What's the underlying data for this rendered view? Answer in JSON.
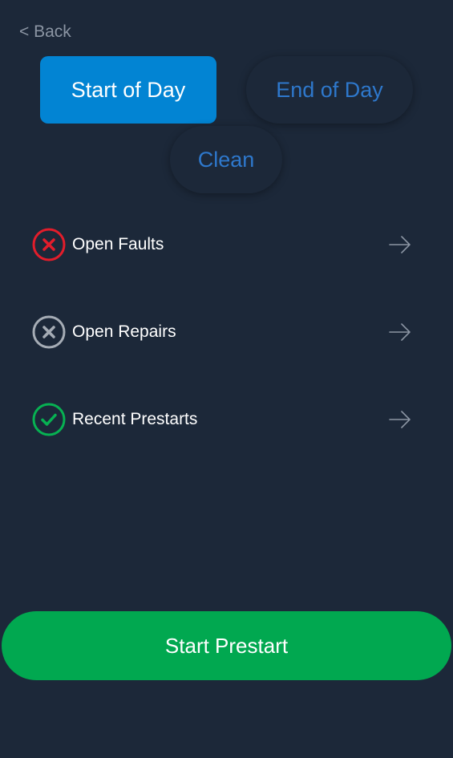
{
  "nav": {
    "back_label": "< Back"
  },
  "tabs": [
    {
      "label": "Start of Day",
      "active": true
    },
    {
      "label": "End of Day",
      "active": false
    },
    {
      "label": "Clean",
      "active": false
    }
  ],
  "list": [
    {
      "label": "Open Faults",
      "status_icon": "x-circle-icon",
      "status_color": "#e21d2b"
    },
    {
      "label": "Open Repairs",
      "status_icon": "x-circle-icon",
      "status_color": "#a5acb5"
    },
    {
      "label": "Recent Prestarts",
      "status_icon": "check-circle-icon",
      "status_color": "#07b152"
    }
  ],
  "cta": {
    "label": "Start Prestart"
  },
  "colors": {
    "background": "#1c2839",
    "active_tab": "#0284d3",
    "inactive_tab_text": "#2e78cc",
    "primary_button": "#01a850"
  }
}
